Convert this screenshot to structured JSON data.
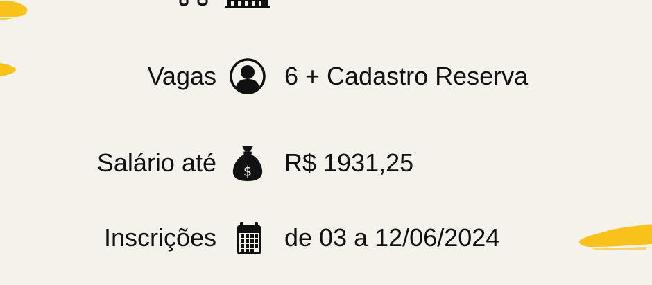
{
  "rows": [
    {
      "label": "Vagas",
      "icon": "user-icon",
      "value": "6 + Cadastro Reserva"
    },
    {
      "label": "Salário até",
      "icon": "money-bag-icon",
      "value": "R$ 1931,25"
    },
    {
      "label": "Inscrições",
      "icon": "calendar-icon",
      "value": "de 03 a 12/06/2024"
    }
  ],
  "colors": {
    "background": "#f4f2ea",
    "accent": "#f7c21a",
    "text": "#111111"
  }
}
